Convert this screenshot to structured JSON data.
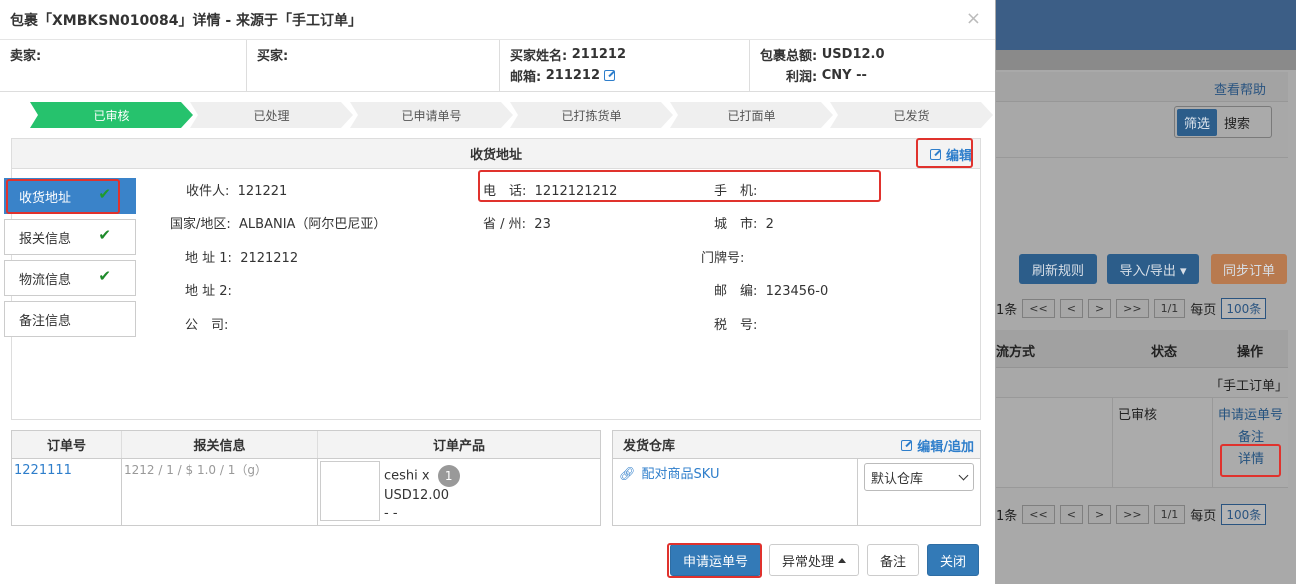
{
  "background": {
    "help_link": "查看帮助",
    "seg_filter": "筛选",
    "seg_search": "搜索",
    "btn_refresh": "刷新规则",
    "btn_import_export": "导入/导出 ▾",
    "btn_sync": "同步订单",
    "pager_count": "1条",
    "pager_first": "<<",
    "pager_prev": "<",
    "pager_next": ">",
    "pager_last": ">>",
    "pager_page": "1/1",
    "pager_per_label": "每页",
    "pager_per_value": "100条",
    "col_logistics": "流方式",
    "col_status": "状态",
    "col_action": "操作",
    "row_source": "「手工订单」",
    "row_status": "已审核",
    "row_action_apply": "申请运单号",
    "row_action_note": "备注",
    "row_action_detail": "详情",
    "colors": {
      "topbar": "#3c5e86",
      "btn_primary": "#2c5d8a",
      "btn_sync": "#b87a4f"
    }
  },
  "modal": {
    "title": "包裹「XMBKSN010084」详情 - 来源于「手工订单」",
    "close": "×",
    "info": {
      "seller_label": "卖家:",
      "buyer_label": "买家:",
      "buyer_name_label": "买家姓名:",
      "buyer_name": "211212",
      "email_label": "邮箱:",
      "email": "211212",
      "total_label": "包裹总额:",
      "total": "USD12.0",
      "profit_label": "利润:",
      "profit": "CNY --"
    },
    "steps": [
      "已审核",
      "已处理",
      "已申请单号",
      "已打拣货单",
      "已打面单",
      "已发货"
    ],
    "address": {
      "heading": "收货地址",
      "edit": "编辑",
      "tabs": [
        {
          "label": "收货地址",
          "checked": "✔"
        },
        {
          "label": "报关信息",
          "checked": "✔"
        },
        {
          "label": "物流信息",
          "checked": "✔"
        },
        {
          "label": "备注信息",
          "checked": ""
        }
      ],
      "recipient_label": "收件人:",
      "recipient": "121221",
      "phone_label": "电　话:",
      "phone": "1212121212",
      "mobile_label": "手　机:",
      "mobile": "",
      "country_label": "国家/地区:",
      "country": "ALBANIA（阿尔巴尼亚）",
      "province_label": "省 / 州:",
      "province": "23",
      "city_label": "城　市:",
      "city": "2",
      "addr1_label": "地 址 1:",
      "addr1": "2121212",
      "house_label": "门牌号:",
      "house": "",
      "addr2_label": "地 址 2:",
      "addr2": "",
      "zip_label": "邮　编:",
      "zip": "123456-0",
      "company_label": "公　司:",
      "company": "",
      "tax_label": "税　号:",
      "tax": ""
    },
    "order": {
      "col_no": "订单号",
      "col_customs": "报关信息",
      "col_product": "订单产品",
      "no": "1221111",
      "customs": "1212 / 1 / $ 1.0 / 1（g）",
      "product_name": "ceshi x",
      "qty": "1",
      "price": "USD12.00",
      "extra": "- -"
    },
    "warehouse": {
      "heading": "发货仓库",
      "edit": "编辑/追加",
      "match_sku": "配对商品SKU",
      "select_value": "默认仓库"
    },
    "buttons": {
      "apply": "申请运单号",
      "exception": "异常处理",
      "note": "备注",
      "close": "关闭"
    }
  }
}
